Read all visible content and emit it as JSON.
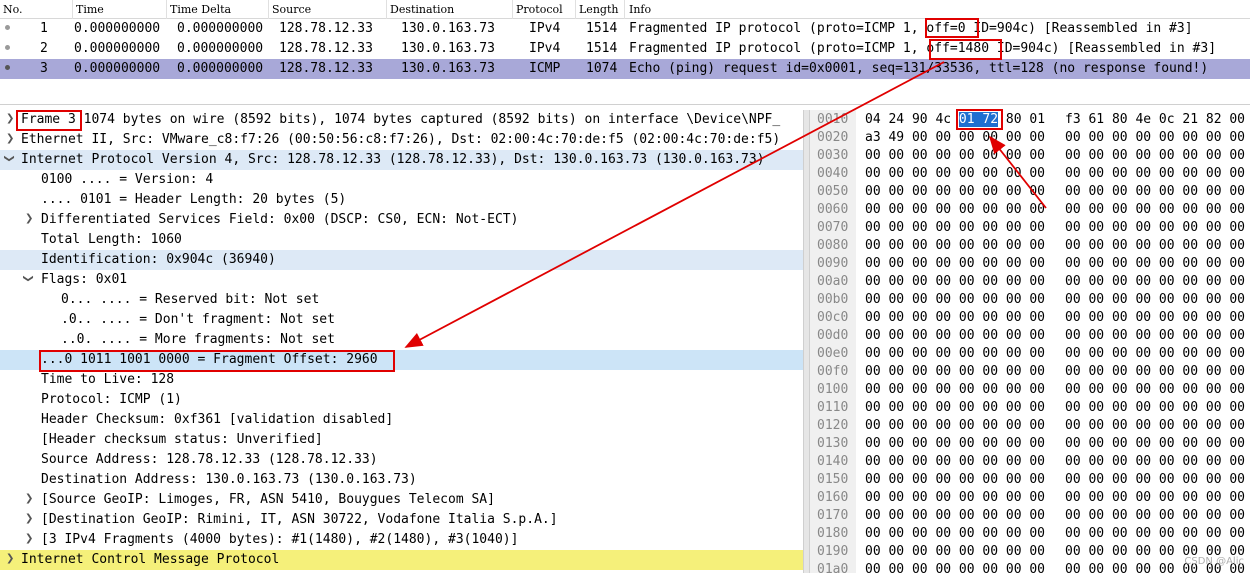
{
  "packet_list": {
    "columns": [
      "No.",
      "Time",
      "Time Delta",
      "Source",
      "Destination",
      "Protocol",
      "Length",
      "Info"
    ],
    "rows": [
      {
        "no": "1",
        "time": "0.000000000",
        "delta": "0.000000000",
        "src": "128.78.12.33",
        "dst": "130.0.163.73",
        "proto": "IPv4",
        "len": "1514",
        "info_pre": "Fragmented IP protocol (proto=ICMP 1, ",
        "info_hl": "off=0",
        "info_post": " ID=904c) [Reassembled in #3]"
      },
      {
        "no": "2",
        "time": "0.000000000",
        "delta": "0.000000000",
        "src": "128.78.12.33",
        "dst": "130.0.163.73",
        "proto": "IPv4",
        "len": "1514",
        "info_pre": "Fragmented IP protocol (proto=ICMP 1, ",
        "info_hl": "off=1480",
        "info_post": " ID=904c) [Reassembled in #3]"
      },
      {
        "no": "3",
        "time": "0.000000000",
        "delta": "0.000000000",
        "src": "128.78.12.33",
        "dst": "130.0.163.73",
        "proto": "ICMP",
        "len": "1074",
        "info_pre": "Echo (ping) request  id=0x0001, seq=131/33536, ttl=128 (no response found!)",
        "info_hl": "",
        "info_post": ""
      }
    ]
  },
  "detail": {
    "frame_label": "Frame 3",
    "frame_rest": " 1074 bytes on wire (8592 bits), 1074 bytes captured (8592 bits) on interface \\Device\\NPF_",
    "ethernet": "Ethernet II, Src: VMware_c8:f7:26 (00:50:56:c8:f7:26), Dst: 02:00:4c:70:de:f5 (02:00:4c:70:de:f5)",
    "ip": "Internet Protocol Version 4, Src: 128.78.12.33 (128.78.12.33), Dst: 130.0.163.73 (130.0.163.73)",
    "version": "0100 .... = Version: 4",
    "header_len": ".... 0101 = Header Length: 20 bytes (5)",
    "dsf": "Differentiated Services Field: 0x00 (DSCP: CS0, ECN: Not-ECT)",
    "total_len": "Total Length: 1060",
    "ident": "Identification: 0x904c (36940)",
    "flags": "Flags: 0x01",
    "reserved": "0... .... = Reserved bit: Not set",
    "dont_frag": ".0.. .... = Don't fragment: Not set",
    "more_frag": "..0. .... = More fragments: Not set",
    "frag_offset": "...0 1011 1001 0000 = Fragment Offset: 2960",
    "ttl": "Time to Live: 128",
    "protocol": "Protocol: ICMP (1)",
    "checksum": "Header Checksum: 0xf361 [validation disabled]",
    "checksum_status": "[Header checksum status: Unverified]",
    "src_addr": "Source Address: 128.78.12.33 (128.78.12.33)",
    "dst_addr": "Destination Address: 130.0.163.73 (130.0.163.73)",
    "src_geo": "[Source GeoIP: Limoges, FR, ASN 5410, Bouygues Telecom SA]",
    "dst_geo": "[Destination GeoIP: Rimini, IT, ASN 30722, Vodafone Italia S.p.A.]",
    "frags": "[3 IPv4 Fragments (4000 bytes): #1(1480), #2(1480), #3(1040)]",
    "icmp": "Internet Control Message Protocol"
  },
  "bytes": {
    "row0_pre": "04 24 90 4c ",
    "row0_sel": "01 72",
    "row0_post": " 80 01",
    "row0_hex2": "f3 61 80 4e 0c 21 82 00",
    "row1_hex": "a3 49 00 00 00 00 00 00",
    "row1_hex2": "00 00 00 00 00 00 00 00",
    "zero_hex": "00 00 00 00 00 00 00 00",
    "offsets": [
      "0010",
      "0020",
      "0030",
      "0040",
      "0050",
      "0060",
      "0070",
      "0080",
      "0090",
      "00a0",
      "00b0",
      "00c0",
      "00d0",
      "00e0",
      "00f0",
      "0100",
      "0110",
      "0120",
      "0130",
      "0140",
      "0150",
      "0160",
      "0170",
      "0180",
      "0190",
      "01a0"
    ]
  },
  "watermark": "CSDN @Alic",
  "colors": {
    "selected_row": "#a8a8d8",
    "highlight_row": "#cce4f7",
    "icmp_row": "#f5f07a",
    "annotation": "#e00000",
    "selected_bytes": "#1f6fd0"
  }
}
